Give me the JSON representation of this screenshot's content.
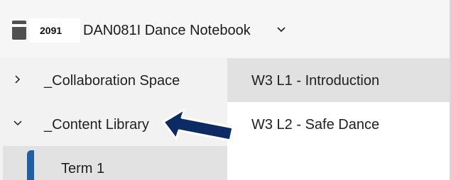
{
  "header": {
    "badge": "2091",
    "notebook_title": "DAN081I Dance Notebook"
  },
  "sections": [
    {
      "label": "_Collaboration Space",
      "state": "collapsed"
    },
    {
      "label": "_Content Library",
      "state": "expanded"
    },
    {
      "label": "Term 1",
      "state": "selected"
    }
  ],
  "pages": [
    {
      "label": "W3 L1 - Introduction",
      "selected": true
    },
    {
      "label": "W3 L2 - Safe Dance",
      "selected": false
    }
  ],
  "colors": {
    "arrow": "#0c2a63",
    "section_tab": "#1f5fa3",
    "selected_bg": "#e1e1e1"
  }
}
